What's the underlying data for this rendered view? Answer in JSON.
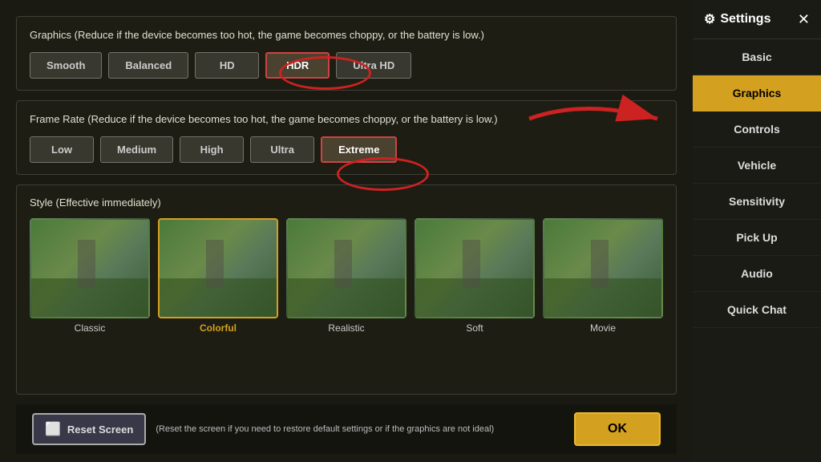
{
  "settings": {
    "title": "Settings",
    "close_label": "✕",
    "gear_icon": "⚙"
  },
  "sidebar": {
    "items": [
      {
        "id": "basic",
        "label": "Basic",
        "active": false
      },
      {
        "id": "graphics",
        "label": "Graphics",
        "active": true
      },
      {
        "id": "controls",
        "label": "Controls",
        "active": false
      },
      {
        "id": "vehicle",
        "label": "Vehicle",
        "active": false
      },
      {
        "id": "sensitivity",
        "label": "Sensitivity",
        "active": false
      },
      {
        "id": "pickup",
        "label": "Pick Up",
        "active": false
      },
      {
        "id": "audio",
        "label": "Audio",
        "active": false
      },
      {
        "id": "quickchat",
        "label": "Quick Chat",
        "active": false
      }
    ]
  },
  "graphics": {
    "section1_label": "Graphics (Reduce if the device becomes too hot, the game becomes choppy, or the battery is low.)",
    "graphics_options": [
      {
        "id": "smooth",
        "label": "Smooth",
        "active": false
      },
      {
        "id": "balanced",
        "label": "Balanced",
        "active": false
      },
      {
        "id": "hd",
        "label": "HD",
        "active": false
      },
      {
        "id": "hdr",
        "label": "HDR",
        "active": true
      },
      {
        "id": "ultrahd",
        "label": "Ultra HD",
        "active": false
      }
    ],
    "section2_label": "Frame Rate (Reduce if the device becomes too hot, the game becomes choppy, or the battery is low.)",
    "framerate_options": [
      {
        "id": "low",
        "label": "Low",
        "active": false
      },
      {
        "id": "medium",
        "label": "Medium",
        "active": false
      },
      {
        "id": "high",
        "label": "High",
        "active": false
      },
      {
        "id": "ultra",
        "label": "Ultra",
        "active": false
      },
      {
        "id": "extreme",
        "label": "Extreme",
        "active": true
      }
    ],
    "style_section_label": "Style (Effective immediately)",
    "styles": [
      {
        "id": "classic",
        "label": "Classic",
        "active": false
      },
      {
        "id": "colorful",
        "label": "Colorful",
        "active": true
      },
      {
        "id": "realistic",
        "label": "Realistic",
        "active": false
      },
      {
        "id": "soft",
        "label": "Soft",
        "active": false
      },
      {
        "id": "movie",
        "label": "Movie",
        "active": false
      }
    ]
  },
  "bottom_bar": {
    "reset_label": "Reset Screen",
    "reset_icon": "⬜",
    "reset_desc": "(Reset the screen if you need to restore default settings or if the graphics are not ideal)",
    "ok_label": "OK"
  }
}
